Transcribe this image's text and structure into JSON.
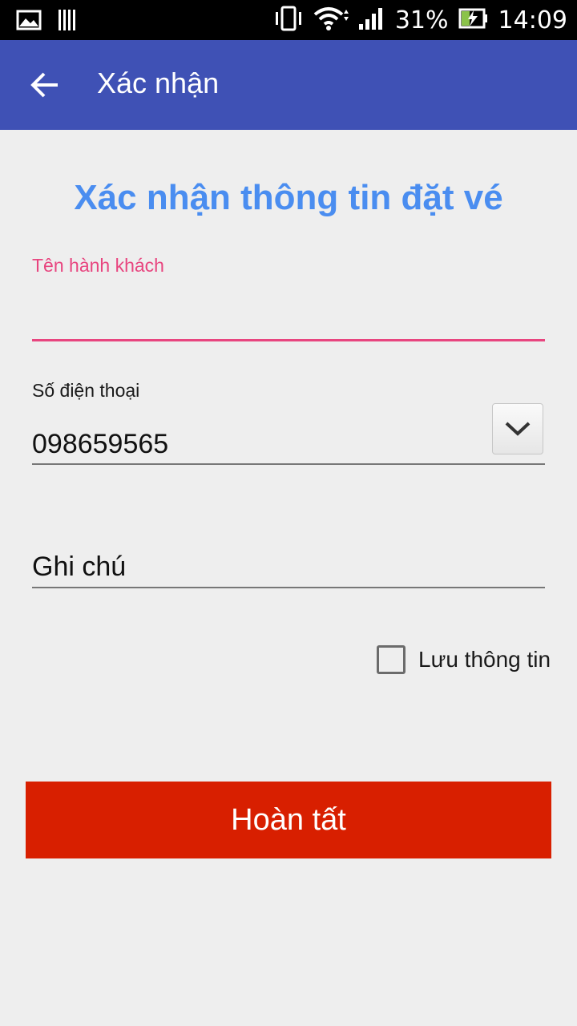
{
  "status_bar": {
    "battery_percent": "31%",
    "time": "14:09",
    "icons": [
      "gallery-icon",
      "barcode-icon",
      "vibrate-icon",
      "wifi-icon",
      "signal-icon",
      "battery-charging-icon"
    ]
  },
  "app_bar": {
    "title": "Xác nhận",
    "background": "#3f51b5"
  },
  "form": {
    "heading": "Xác nhận thông tin đặt vé",
    "passenger_name": {
      "label": "Tên hành khách",
      "value": ""
    },
    "phone": {
      "label": "Số điện thoại",
      "value": "098659565"
    },
    "note": {
      "placeholder": "Ghi chú",
      "value": ""
    },
    "save_info": {
      "label": "Lưu thông tin",
      "checked": false
    },
    "submit_label": "Hoàn tất"
  },
  "colors": {
    "accent_pink": "#e8457f",
    "heading_blue": "#4a8df0",
    "submit_red": "#d81f00",
    "background": "#eeeeee"
  }
}
